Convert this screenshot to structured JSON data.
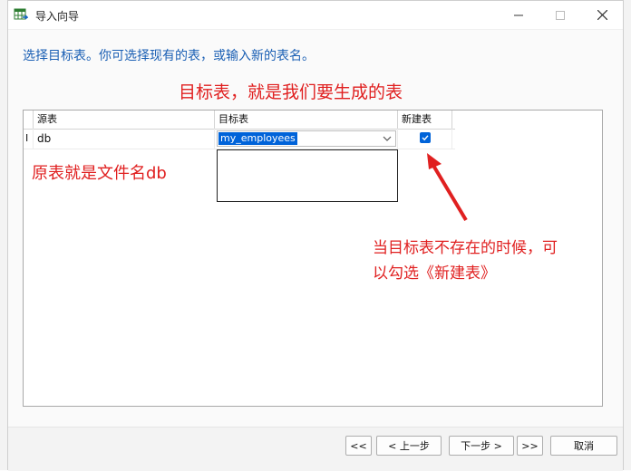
{
  "window": {
    "title": "导入向导",
    "minimize_icon": "minimize-icon",
    "maximize_icon": "maximize-icon",
    "close_icon": "close-icon"
  },
  "instruction": "选择目标表。你可选择现有的表，或输入新的表名。",
  "table": {
    "headers": [
      "源表",
      "目标表",
      "新建表"
    ],
    "rows": [
      {
        "source": "db",
        "target": "my_employees",
        "new_table": true
      }
    ]
  },
  "annotations": {
    "target_note": "目标表，就是我们要生成的表",
    "source_note": "原表就是文件名db",
    "new_table_note_line1": "当目标表不存在的时候，可",
    "new_table_note_line2": "以勾选《新建表》"
  },
  "buttons": {
    "first": "<<",
    "prev": "< 上一步",
    "next": "下一步 >",
    "last": ">>",
    "cancel": "取消"
  },
  "colors": {
    "accent": "#0063d9",
    "instruction_text": "#1a5fb4",
    "annotation": "#e02020"
  }
}
